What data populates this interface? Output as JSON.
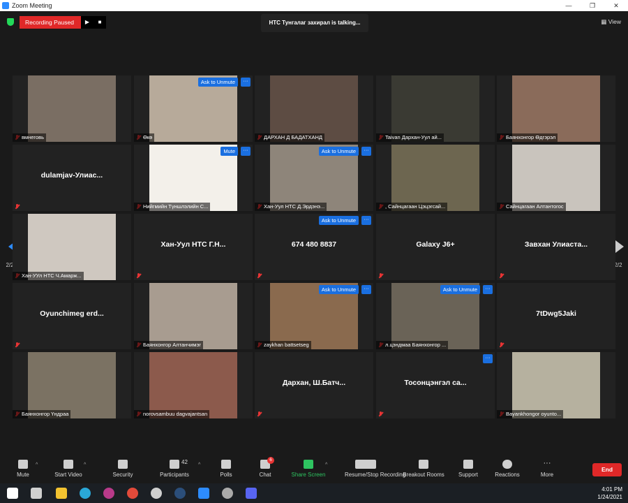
{
  "window": {
    "title": "Zoom Meeting"
  },
  "recording": {
    "status": "Recording Paused"
  },
  "talking": "НТС Тунгалаг захирал is talking...",
  "view_label": "View",
  "pager": {
    "left": "2/2",
    "right": "2/2"
  },
  "tiles": [
    {
      "name": "вмнеговь",
      "big": "",
      "photo": "#7a6e63",
      "ask": false,
      "mute": false,
      "more": false
    },
    {
      "name": "Өкө",
      "big": "",
      "photo": "#b7aa9a",
      "ask": true,
      "mute": false,
      "more": true
    },
    {
      "name": "ДАРХАН Д БАДАТХАНД",
      "big": "",
      "photo": "#5d4c43",
      "ask": false,
      "mute": false,
      "more": false
    },
    {
      "name": "Taivan Дархан-Уул ай...",
      "big": "",
      "photo": "#3a3a33",
      "ask": false,
      "mute": false,
      "more": false
    },
    {
      "name": "Баянхонгор Өдгэрэл",
      "big": "",
      "photo": "#8a6b5a",
      "ask": false,
      "mute": false,
      "more": false
    },
    {
      "name": "",
      "big": "dulamjav-Улиас...",
      "photo": "",
      "ask": false,
      "mute": false,
      "more": false
    },
    {
      "name": "Нийгмийн Түншлэлийн С...",
      "big": "",
      "photo": "#f3f0ea",
      "ask": false,
      "mute": true,
      "more": true
    },
    {
      "name": "Хан-Уул НТС Д.Эрдэнэ...",
      "big": "",
      "photo": "#8e857a",
      "ask": true,
      "mute": false,
      "more": true
    },
    {
      "name": ", Сайнцагаан Цэцэгсай...",
      "big": "",
      "photo": "#6d6650",
      "ask": false,
      "mute": false,
      "more": false
    },
    {
      "name": "Сайнцагаан Алтантогос",
      "big": "",
      "photo": "#c9c4bd",
      "ask": false,
      "mute": false,
      "more": false
    },
    {
      "name": "Хан-УУл НТС Ч.Амарж...",
      "big": "",
      "photo": "#cfc8c0",
      "ask": false,
      "mute": false,
      "more": false
    },
    {
      "name": "",
      "big": "Хан-Уул НТС Г.Н...",
      "photo": "",
      "ask": false,
      "mute": false,
      "more": false
    },
    {
      "name": "",
      "big": "674 480 8837",
      "photo": "",
      "ask": true,
      "mute": false,
      "more": true
    },
    {
      "name": "",
      "big": "Galaxy J6+",
      "photo": "",
      "ask": false,
      "mute": false,
      "more": false
    },
    {
      "name": "",
      "big": "Завхан Улиаста...",
      "photo": "",
      "ask": false,
      "mute": false,
      "more": false
    },
    {
      "name": "",
      "big": "Oyunchimeg erd...",
      "photo": "",
      "ask": false,
      "mute": false,
      "more": false
    },
    {
      "name": "Баянхонгор Алтанчимэг",
      "big": "",
      "photo": "#a89c90",
      "ask": false,
      "mute": false,
      "more": false
    },
    {
      "name": "zaykhan battsetseg",
      "big": "",
      "photo": "#8a6a4e",
      "ask": true,
      "mute": false,
      "more": true
    },
    {
      "name": "л.цэндмаа Баянхонгор ...",
      "big": "",
      "photo": "#6a6357",
      "ask": true,
      "mute": false,
      "more": true
    },
    {
      "name": "",
      "big": "7tDwg5Jaki",
      "photo": "",
      "ask": false,
      "mute": false,
      "more": false
    },
    {
      "name": "Баянхонгор Үндраа",
      "big": "",
      "photo": "#7b7263",
      "ask": false,
      "mute": false,
      "more": false
    },
    {
      "name": "norovsambuu dagvajantsan",
      "big": "",
      "photo": "#8c5a4c",
      "ask": false,
      "mute": false,
      "more": false
    },
    {
      "name": "",
      "big": "Дархан, Ш.Батч...",
      "photo": "",
      "ask": false,
      "mute": false,
      "more": false
    },
    {
      "name": "",
      "big": "Тосонцэнгэл са...",
      "photo": "",
      "ask": false,
      "mute": false,
      "more": true
    },
    {
      "name": "Bayankhongor oyunto...",
      "big": "",
      "photo": "#b6b19f",
      "ask": false,
      "mute": false,
      "more": false
    }
  ],
  "labels": {
    "ask": "Ask to Unmute",
    "mute": "Mute",
    "more": "···"
  },
  "toolbar": {
    "mute": "Mute",
    "video": "Start Video",
    "security": "Security",
    "participants": "Participants",
    "participants_count": "42",
    "polls": "Polls",
    "chat": "Chat",
    "chat_badge": "6",
    "share": "Share Screen",
    "record": "Resume/Stop Recording",
    "breakout": "Breakout Rooms",
    "support": "Support",
    "reactions": "Reactions",
    "more": "More",
    "end": "End"
  },
  "clock": {
    "time": "4:01 PM",
    "date": "1/24/2021"
  }
}
